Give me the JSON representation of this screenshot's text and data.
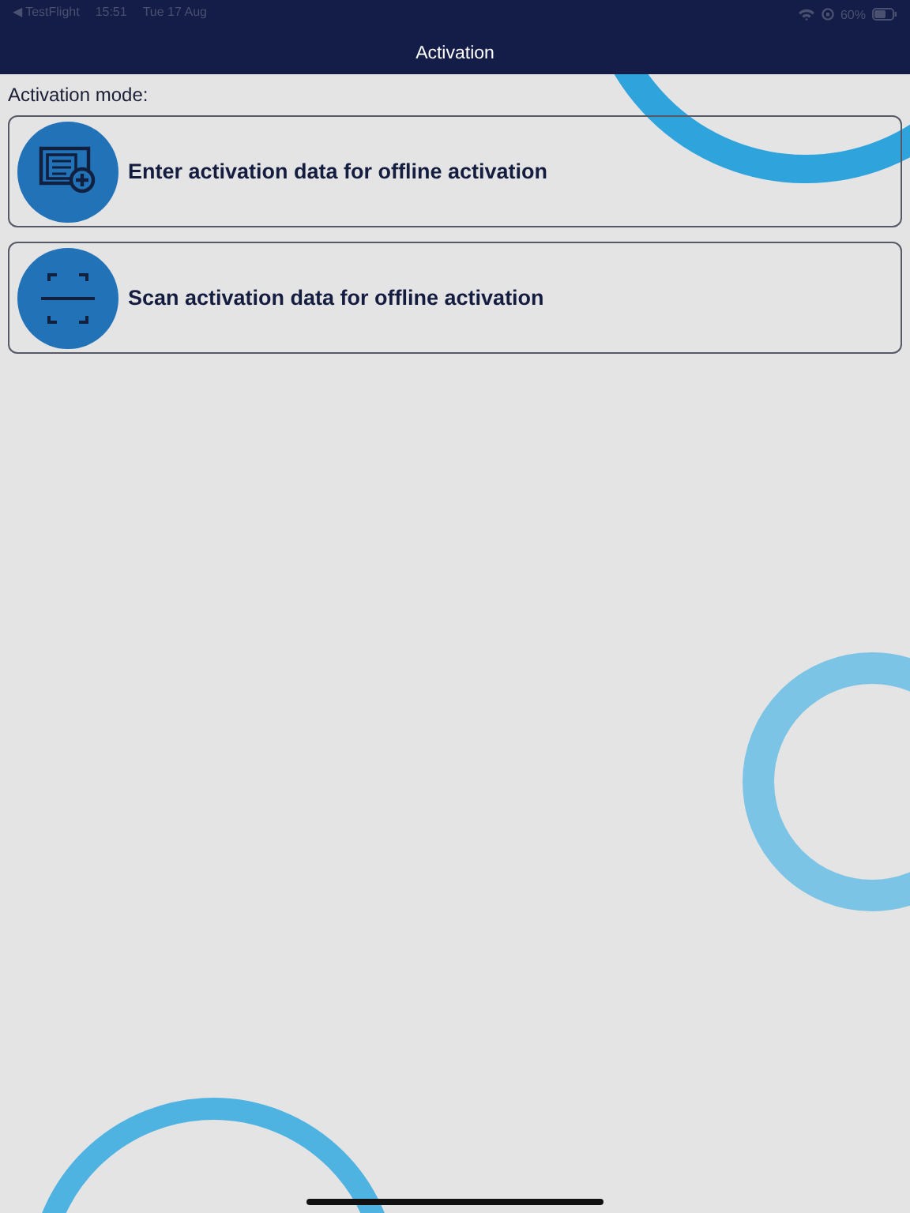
{
  "status_bar": {
    "back_app": "◀ TestFlight",
    "time": "15:51",
    "date": "Tue 17 Aug",
    "battery": "60%"
  },
  "nav_bar": {
    "title": "Activation"
  },
  "section_label": "Activation mode:",
  "options": [
    {
      "kind": "enter",
      "label": "Enter activation data for offline activation"
    },
    {
      "kind": "scan",
      "label": "Scan activation data for offline activation"
    }
  ]
}
